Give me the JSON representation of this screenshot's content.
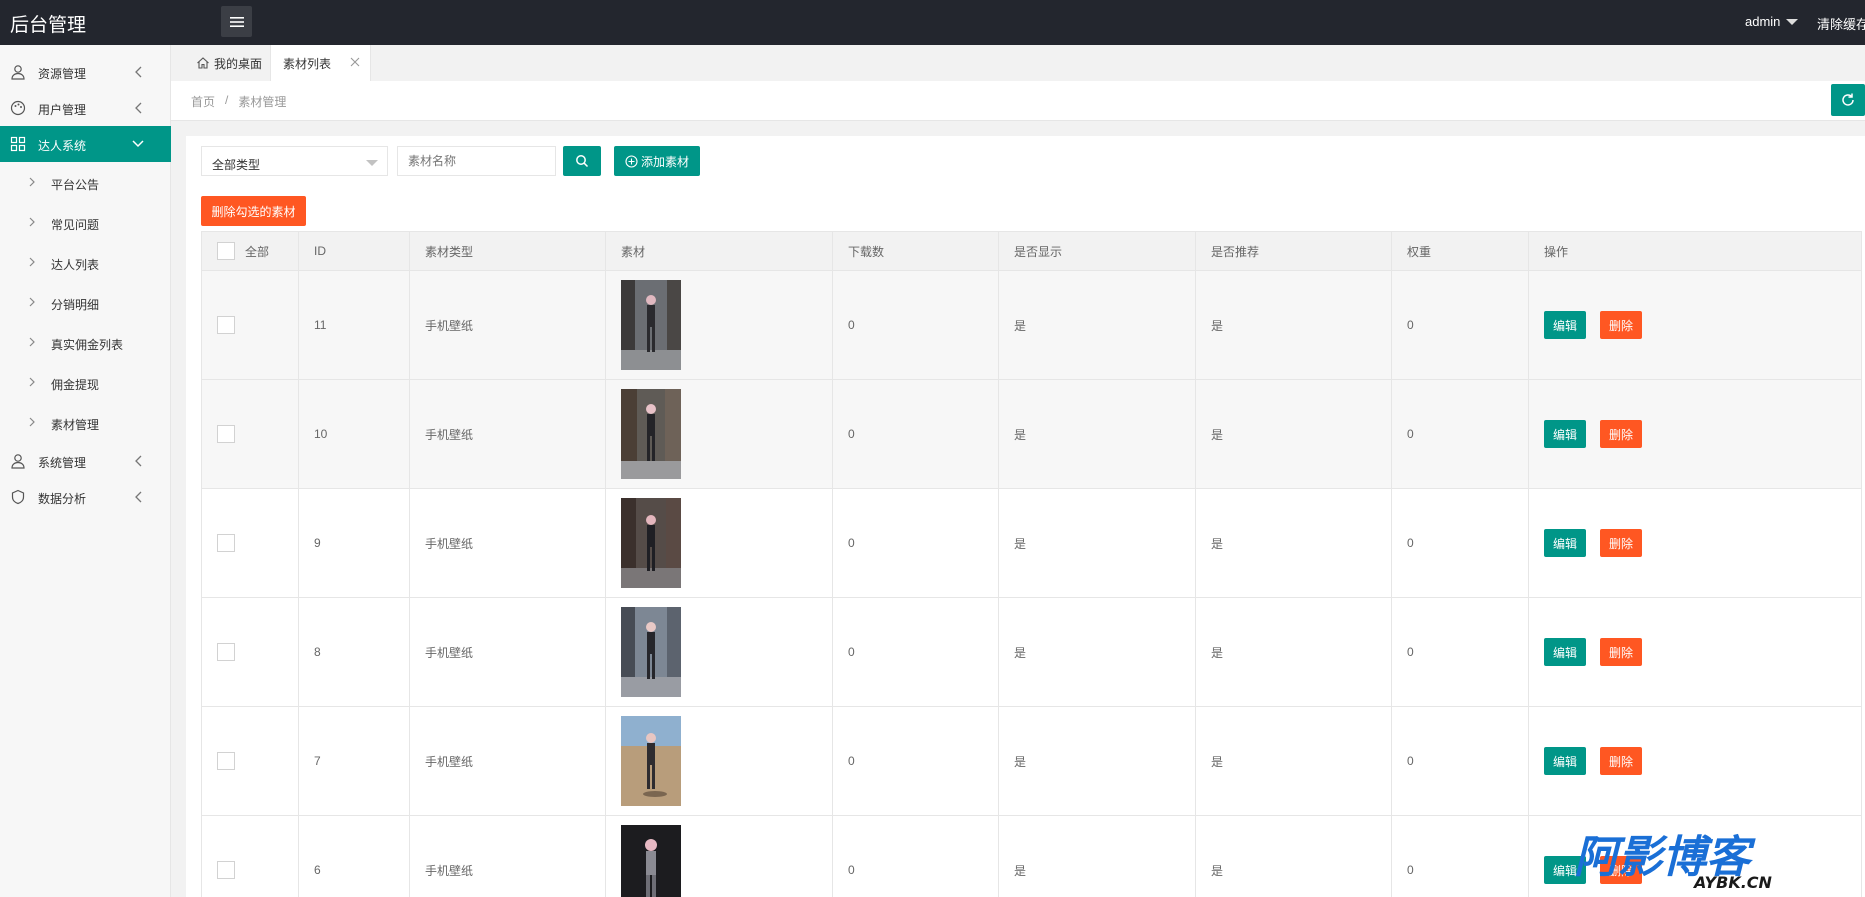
{
  "header": {
    "title": "后台管理",
    "user": "admin",
    "clear_cache": "清除缓存"
  },
  "sidebar": {
    "items": [
      {
        "label": "资源管理",
        "icon": "user-icon"
      },
      {
        "label": "用户管理",
        "icon": "palette-icon"
      },
      {
        "label": "达人系统",
        "icon": "grid-icon",
        "active": true
      },
      {
        "label": "系统管理",
        "icon": "user-icon"
      },
      {
        "label": "数据分析",
        "icon": "shield-icon"
      }
    ],
    "sub_items": [
      {
        "label": "平台公告"
      },
      {
        "label": "常见问题"
      },
      {
        "label": "达人列表"
      },
      {
        "label": "分销明细"
      },
      {
        "label": "真实佣金列表"
      },
      {
        "label": "佣金提现"
      },
      {
        "label": "素材管理"
      }
    ]
  },
  "tabs": {
    "home": "我的桌面",
    "active": "素材列表"
  },
  "breadcrumb": {
    "home": "首页",
    "sep": "/",
    "current": "素材管理"
  },
  "filters": {
    "type_select": "全部类型",
    "name_placeholder": "素材名称",
    "add_label": "添加素材",
    "delete_selected": "删除勾选的素材"
  },
  "table": {
    "headers": {
      "all": "全部",
      "id": "ID",
      "type": "素材类型",
      "material": "素材",
      "downloads": "下载数",
      "show": "是否显示",
      "recommend": "是否推荐",
      "weight": "权重",
      "ops": "操作"
    },
    "rows": [
      {
        "id": "11",
        "type": "手机壁纸",
        "downloads": "0",
        "show": "是",
        "recommend": "是",
        "weight": "0"
      },
      {
        "id": "10",
        "type": "手机壁纸",
        "downloads": "0",
        "show": "是",
        "recommend": "是",
        "weight": "0"
      },
      {
        "id": "9",
        "type": "手机壁纸",
        "downloads": "0",
        "show": "是",
        "recommend": "是",
        "weight": "0"
      },
      {
        "id": "8",
        "type": "手机壁纸",
        "downloads": "0",
        "show": "是",
        "recommend": "是",
        "weight": "0"
      },
      {
        "id": "7",
        "type": "手机壁纸",
        "downloads": "0",
        "show": "是",
        "recommend": "是",
        "weight": "0"
      },
      {
        "id": "6",
        "type": "手机壁纸",
        "downloads": "0",
        "show": "是",
        "recommend": "是",
        "weight": "0"
      }
    ],
    "edit_label": "编辑",
    "delete_label": "删除"
  },
  "watermark": {
    "main": "阿影博客",
    "sub": "AYBK.CN"
  },
  "colors": {
    "header_bg": "#23262e",
    "accent": "#009688",
    "danger": "#ff5722"
  }
}
